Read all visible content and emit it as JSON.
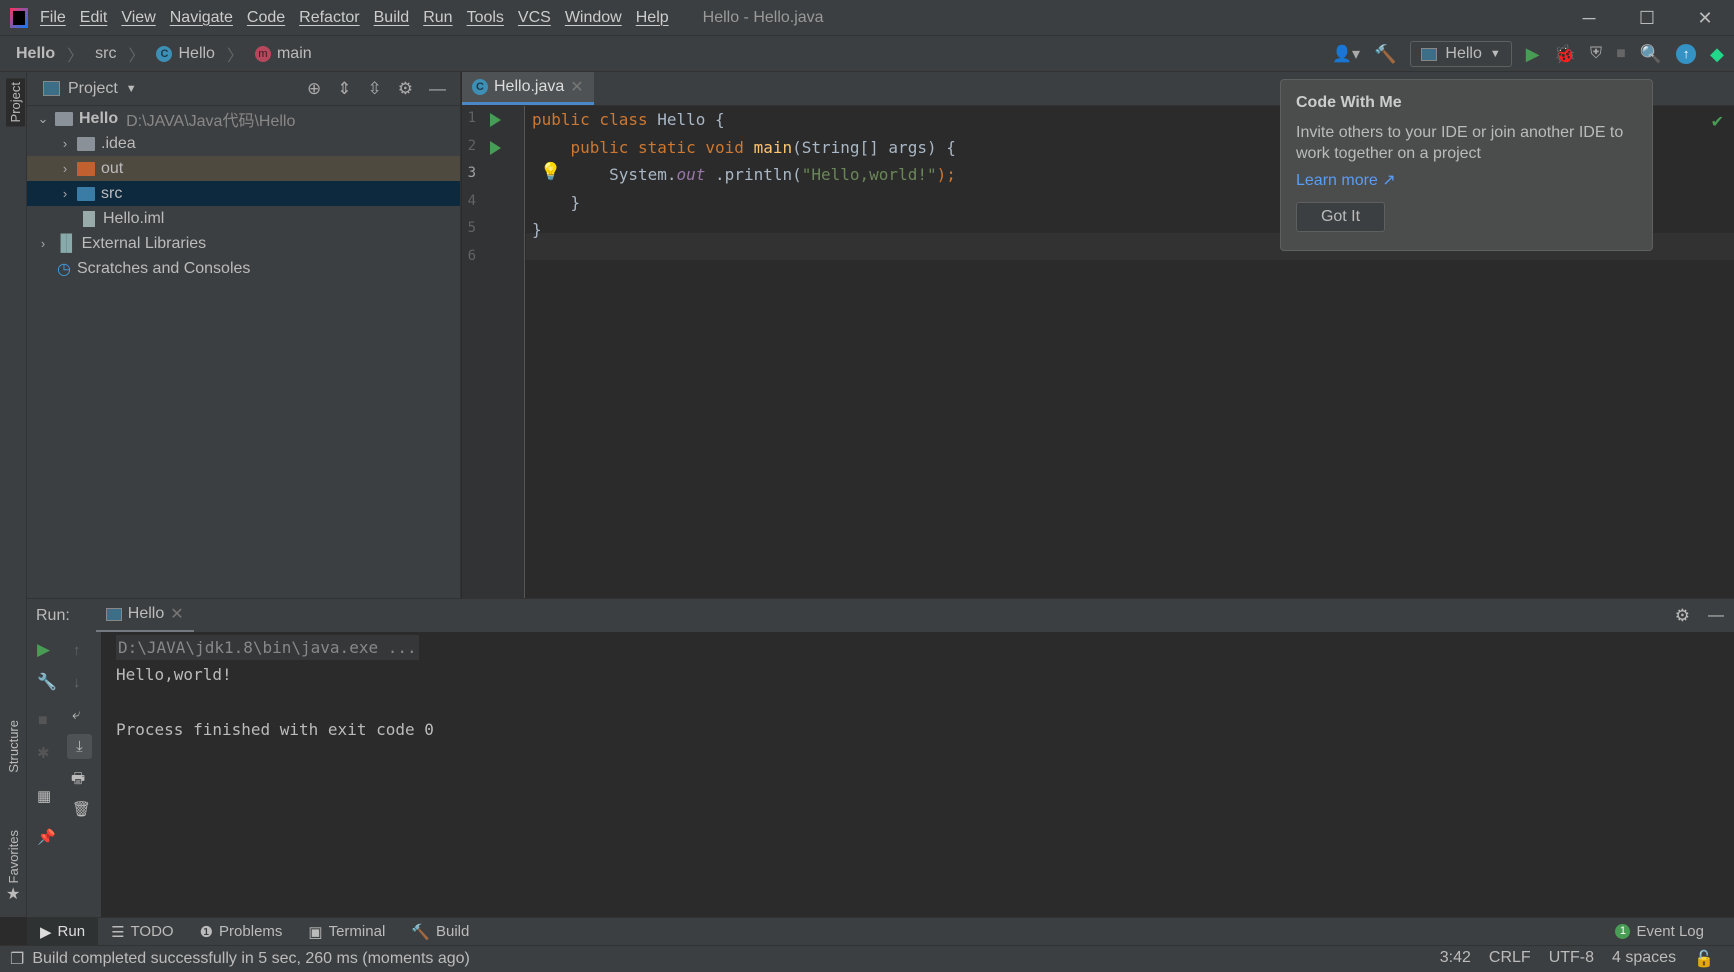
{
  "window": {
    "title": "Hello - Hello.java",
    "menu": [
      "File",
      "Edit",
      "View",
      "Navigate",
      "Code",
      "Refactor",
      "Build",
      "Run",
      "Tools",
      "VCS",
      "Window",
      "Help"
    ]
  },
  "breadcrumb": [
    "Hello",
    "src",
    "Hello",
    "main"
  ],
  "toolbar": {
    "run_config": "Hello"
  },
  "project": {
    "header": "Project",
    "tree": [
      {
        "label": "Hello",
        "path": "D:\\JAVA\\Java代码\\Hello"
      },
      {
        "label": ".idea"
      },
      {
        "label": "out"
      },
      {
        "label": "src"
      },
      {
        "label": "Hello.iml"
      },
      {
        "label": "External Libraries"
      },
      {
        "label": "Scratches and Consoles"
      }
    ]
  },
  "side": {
    "project": "Project",
    "structure": "Structure",
    "favorites": "Favorites"
  },
  "editor": {
    "tab": "Hello.java",
    "line_numbers": [
      "1",
      "2",
      "3",
      "4",
      "5",
      "6"
    ],
    "code": {
      "l1a": "public class ",
      "l1b": "Hello {",
      "l2a": "    public static void ",
      "l2b": "main",
      "l2c": "(String[] args) {",
      "l3a": "        System.",
      "l3b": "out",
      "l3c": " .println(",
      "l3d": "\"Hello,world!\"",
      "l3e": ");",
      "l4": "    }",
      "l5": "}"
    }
  },
  "popup": {
    "title": "Code With Me",
    "body": "Invite others to your IDE or join another IDE to work together on a project",
    "link": "Learn more ↗",
    "button": "Got It"
  },
  "run": {
    "label": "Run:",
    "tab": "Hello",
    "output": [
      "D:\\JAVA\\jdk1.8\\bin\\java.exe ...",
      "Hello,world!",
      "",
      "Process finished with exit code 0"
    ]
  },
  "bottom_tabs": [
    "Run",
    "TODO",
    "Problems",
    "Terminal",
    "Build"
  ],
  "event_log": {
    "count": "1",
    "label": "Event Log"
  },
  "status": {
    "message": "Build completed successfully in 5 sec, 260 ms (moments ago)",
    "position": "3:42",
    "line_sep": "CRLF",
    "encoding": "UTF-8",
    "indent": "4 spaces"
  }
}
